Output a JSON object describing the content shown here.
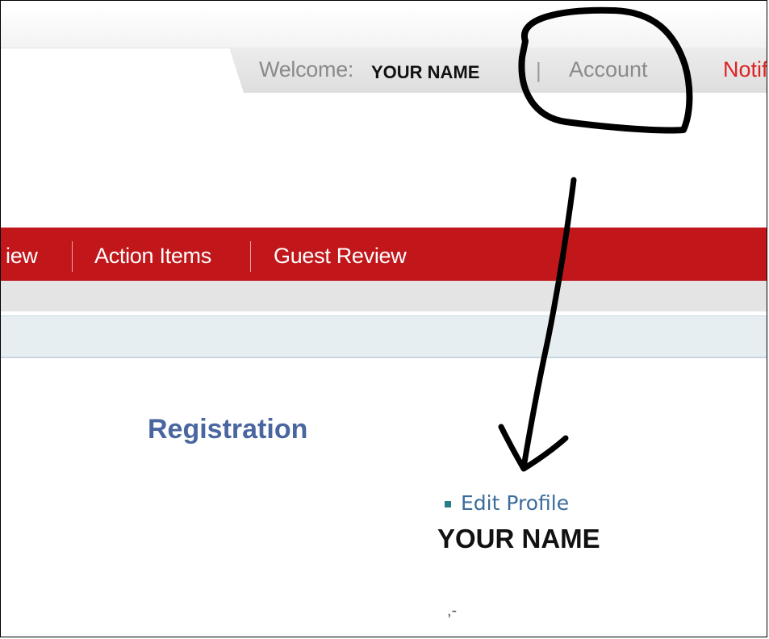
{
  "header": {
    "welcome_label": "Welcome:",
    "user_name": "YOUR NAME",
    "separator": "|",
    "account_link": "Account",
    "notifications_link": "Notifi"
  },
  "nav": {
    "items": [
      "iew",
      "Action Items",
      "Guest Review"
    ]
  },
  "main": {
    "section_title": "Registration",
    "edit_profile_link": "Edit Profile",
    "profile_name": "YOUR NAME",
    "stray_text": ",-"
  },
  "colors": {
    "nav_background": "#c1171b",
    "link_blue": "#4a66a0",
    "notification_red": "#dd2222",
    "annotation_ink": "#000000"
  },
  "annotations": {
    "description_shapes": [
      "circle-around-account",
      "arrow-to-edit-profile"
    ]
  }
}
